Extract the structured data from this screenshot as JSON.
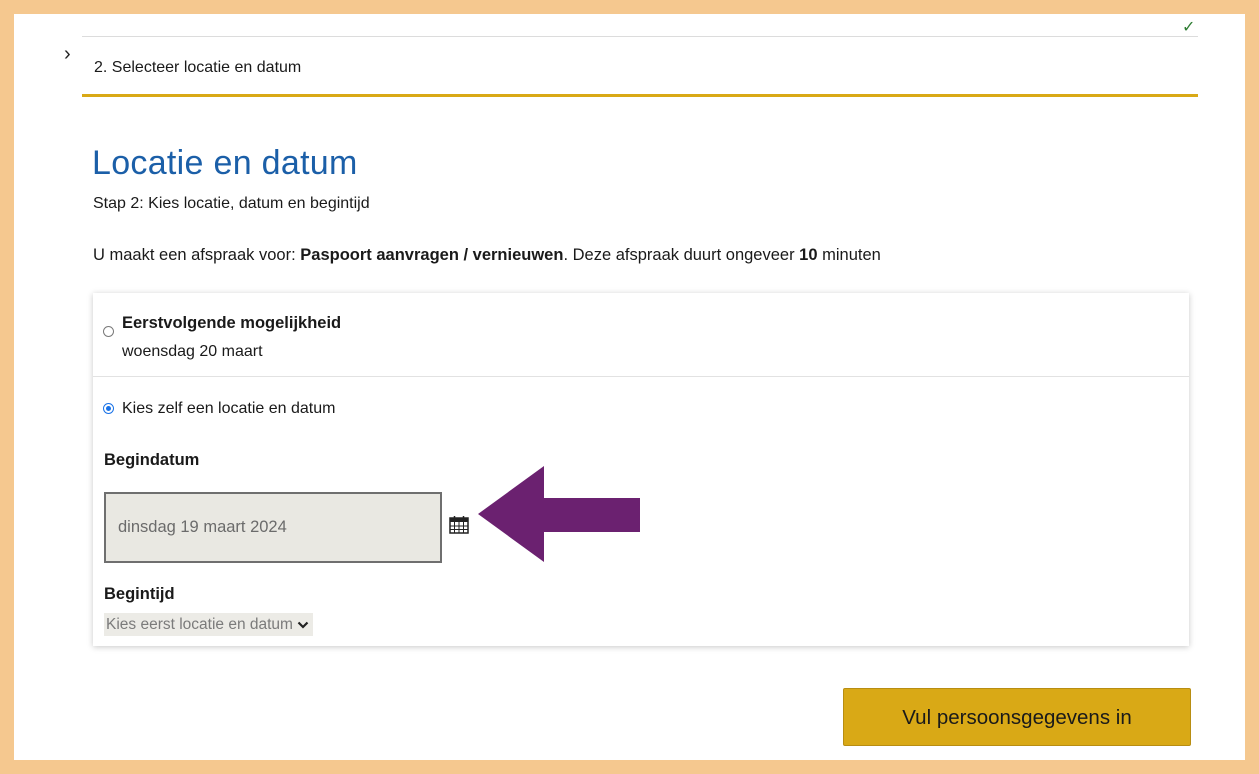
{
  "stepper": {
    "current_step_label": "2. Selecteer locatie en datum",
    "underline_color": "#d9a916"
  },
  "heading": {
    "title": "Locatie en datum",
    "subtitle": "Stap 2: Kies locatie, datum en begintijd"
  },
  "appointment_info": {
    "prefix": "U maakt een afspraak voor: ",
    "service": "Paspoort aanvragen / vernieuwen",
    "middle": ". Deze afspraak duurt ongeveer ",
    "duration": "10",
    "suffix": " minuten"
  },
  "options": {
    "first_available": {
      "title": "Eerstvolgende mogelijkheid",
      "date": "woensdag 20 maart",
      "selected": false
    },
    "choose_own": {
      "label": "Kies zelf een locatie en datum",
      "selected": true
    }
  },
  "begindatum": {
    "label": "Begindatum",
    "value": "dinsdag 19 maart 2024",
    "icon": "calendar-icon"
  },
  "begintijd": {
    "label": "Begintijd",
    "selected_option": "Kies eerst locatie en datum",
    "icon": "chevron-down-icon"
  },
  "annotation": {
    "arrow_color": "#6b2170"
  },
  "actions": {
    "next_button_label": "Vul persoonsgegevens in"
  },
  "colors": {
    "title": "#1b5fa8",
    "accent": "#d9a916",
    "frame": "#f5c88f"
  }
}
